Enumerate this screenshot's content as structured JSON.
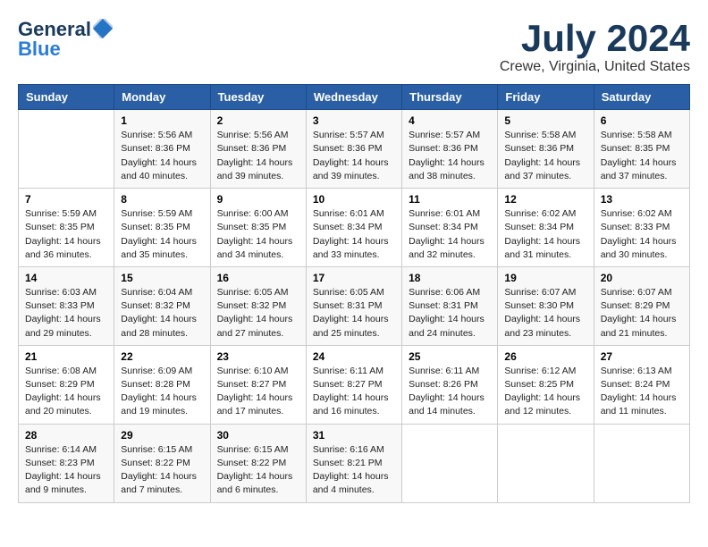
{
  "logo": {
    "line1": "General",
    "line2": "Blue"
  },
  "title": "July 2024",
  "subtitle": "Crewe, Virginia, United States",
  "days_header": [
    "Sunday",
    "Monday",
    "Tuesday",
    "Wednesday",
    "Thursday",
    "Friday",
    "Saturday"
  ],
  "weeks": [
    {
      "cells": [
        {
          "day": "",
          "content": ""
        },
        {
          "day": "1",
          "content": "Sunrise: 5:56 AM\nSunset: 8:36 PM\nDaylight: 14 hours\nand 40 minutes."
        },
        {
          "day": "2",
          "content": "Sunrise: 5:56 AM\nSunset: 8:36 PM\nDaylight: 14 hours\nand 39 minutes."
        },
        {
          "day": "3",
          "content": "Sunrise: 5:57 AM\nSunset: 8:36 PM\nDaylight: 14 hours\nand 39 minutes."
        },
        {
          "day": "4",
          "content": "Sunrise: 5:57 AM\nSunset: 8:36 PM\nDaylight: 14 hours\nand 38 minutes."
        },
        {
          "day": "5",
          "content": "Sunrise: 5:58 AM\nSunset: 8:36 PM\nDaylight: 14 hours\nand 37 minutes."
        },
        {
          "day": "6",
          "content": "Sunrise: 5:58 AM\nSunset: 8:35 PM\nDaylight: 14 hours\nand 37 minutes."
        }
      ]
    },
    {
      "cells": [
        {
          "day": "7",
          "content": "Sunrise: 5:59 AM\nSunset: 8:35 PM\nDaylight: 14 hours\nand 36 minutes."
        },
        {
          "day": "8",
          "content": "Sunrise: 5:59 AM\nSunset: 8:35 PM\nDaylight: 14 hours\nand 35 minutes."
        },
        {
          "day": "9",
          "content": "Sunrise: 6:00 AM\nSunset: 8:35 PM\nDaylight: 14 hours\nand 34 minutes."
        },
        {
          "day": "10",
          "content": "Sunrise: 6:01 AM\nSunset: 8:34 PM\nDaylight: 14 hours\nand 33 minutes."
        },
        {
          "day": "11",
          "content": "Sunrise: 6:01 AM\nSunset: 8:34 PM\nDaylight: 14 hours\nand 32 minutes."
        },
        {
          "day": "12",
          "content": "Sunrise: 6:02 AM\nSunset: 8:34 PM\nDaylight: 14 hours\nand 31 minutes."
        },
        {
          "day": "13",
          "content": "Sunrise: 6:02 AM\nSunset: 8:33 PM\nDaylight: 14 hours\nand 30 minutes."
        }
      ]
    },
    {
      "cells": [
        {
          "day": "14",
          "content": "Sunrise: 6:03 AM\nSunset: 8:33 PM\nDaylight: 14 hours\nand 29 minutes."
        },
        {
          "day": "15",
          "content": "Sunrise: 6:04 AM\nSunset: 8:32 PM\nDaylight: 14 hours\nand 28 minutes."
        },
        {
          "day": "16",
          "content": "Sunrise: 6:05 AM\nSunset: 8:32 PM\nDaylight: 14 hours\nand 27 minutes."
        },
        {
          "day": "17",
          "content": "Sunrise: 6:05 AM\nSunset: 8:31 PM\nDaylight: 14 hours\nand 25 minutes."
        },
        {
          "day": "18",
          "content": "Sunrise: 6:06 AM\nSunset: 8:31 PM\nDaylight: 14 hours\nand 24 minutes."
        },
        {
          "day": "19",
          "content": "Sunrise: 6:07 AM\nSunset: 8:30 PM\nDaylight: 14 hours\nand 23 minutes."
        },
        {
          "day": "20",
          "content": "Sunrise: 6:07 AM\nSunset: 8:29 PM\nDaylight: 14 hours\nand 21 minutes."
        }
      ]
    },
    {
      "cells": [
        {
          "day": "21",
          "content": "Sunrise: 6:08 AM\nSunset: 8:29 PM\nDaylight: 14 hours\nand 20 minutes."
        },
        {
          "day": "22",
          "content": "Sunrise: 6:09 AM\nSunset: 8:28 PM\nDaylight: 14 hours\nand 19 minutes."
        },
        {
          "day": "23",
          "content": "Sunrise: 6:10 AM\nSunset: 8:27 PM\nDaylight: 14 hours\nand 17 minutes."
        },
        {
          "day": "24",
          "content": "Sunrise: 6:11 AM\nSunset: 8:27 PM\nDaylight: 14 hours\nand 16 minutes."
        },
        {
          "day": "25",
          "content": "Sunrise: 6:11 AM\nSunset: 8:26 PM\nDaylight: 14 hours\nand 14 minutes."
        },
        {
          "day": "26",
          "content": "Sunrise: 6:12 AM\nSunset: 8:25 PM\nDaylight: 14 hours\nand 12 minutes."
        },
        {
          "day": "27",
          "content": "Sunrise: 6:13 AM\nSunset: 8:24 PM\nDaylight: 14 hours\nand 11 minutes."
        }
      ]
    },
    {
      "cells": [
        {
          "day": "28",
          "content": "Sunrise: 6:14 AM\nSunset: 8:23 PM\nDaylight: 14 hours\nand 9 minutes."
        },
        {
          "day": "29",
          "content": "Sunrise: 6:15 AM\nSunset: 8:22 PM\nDaylight: 14 hours\nand 7 minutes."
        },
        {
          "day": "30",
          "content": "Sunrise: 6:15 AM\nSunset: 8:22 PM\nDaylight: 14 hours\nand 6 minutes."
        },
        {
          "day": "31",
          "content": "Sunrise: 6:16 AM\nSunset: 8:21 PM\nDaylight: 14 hours\nand 4 minutes."
        },
        {
          "day": "",
          "content": ""
        },
        {
          "day": "",
          "content": ""
        },
        {
          "day": "",
          "content": ""
        }
      ]
    }
  ]
}
